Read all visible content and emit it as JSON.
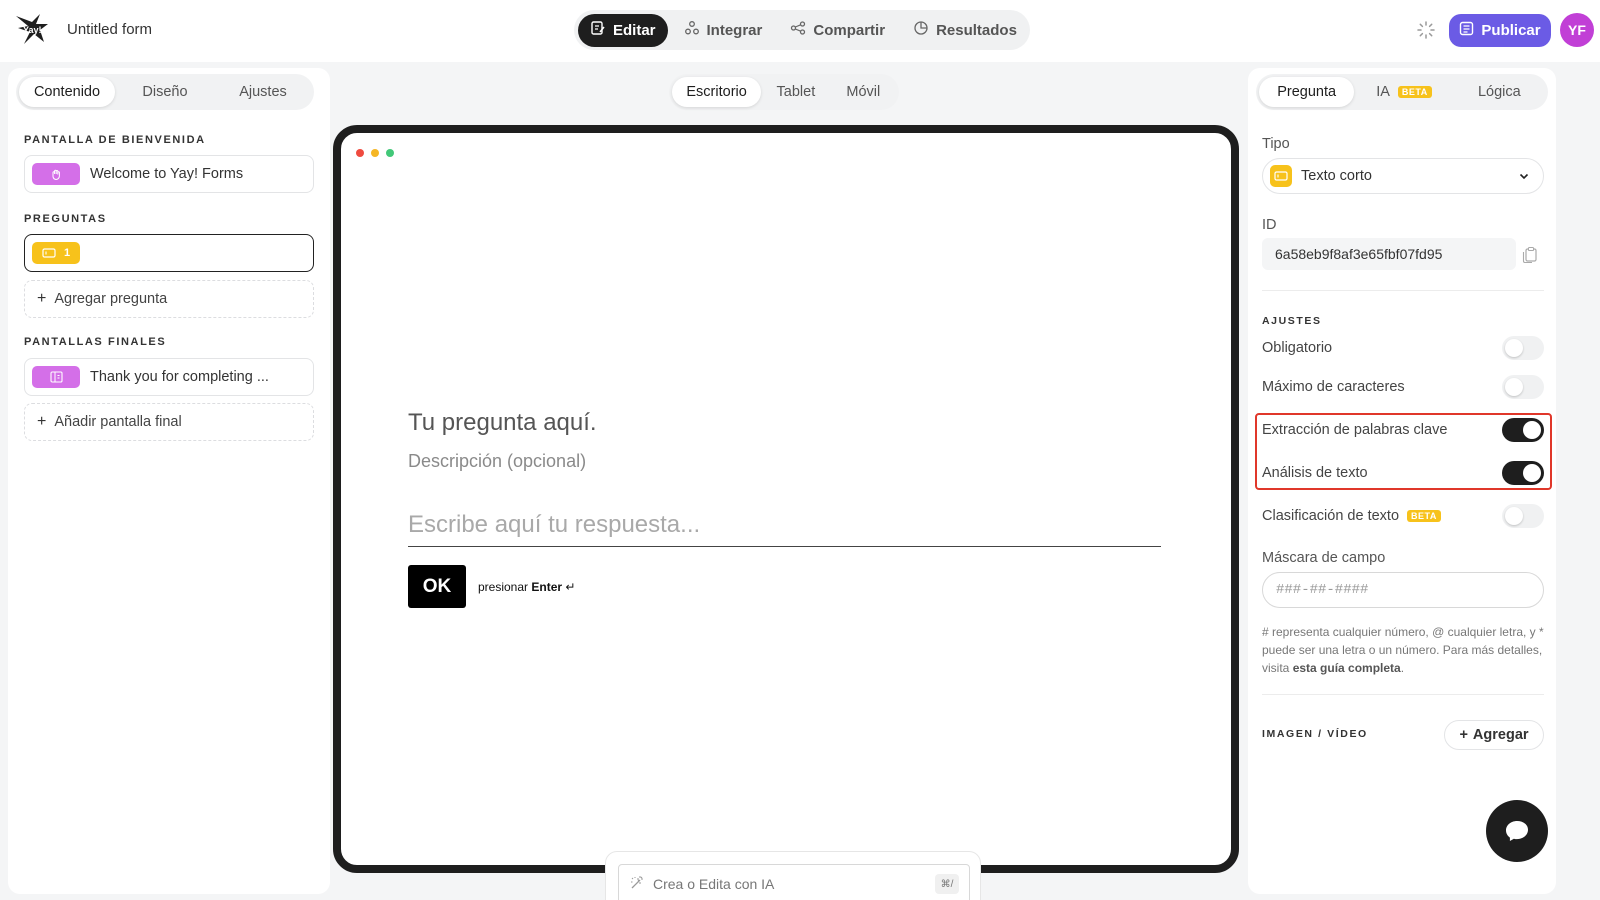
{
  "header": {
    "form_title": "Untitled form",
    "nav": [
      {
        "label": "Editar",
        "icon": "edit-icon",
        "active": true
      },
      {
        "label": "Integrar",
        "icon": "integrate-icon",
        "active": false
      },
      {
        "label": "Compartir",
        "icon": "share-icon",
        "active": false
      },
      {
        "label": "Resultados",
        "icon": "results-icon",
        "active": false
      }
    ],
    "publish_label": "Publicar",
    "avatar_initials": "YF"
  },
  "left": {
    "tabs": [
      {
        "label": "Contenido",
        "active": true
      },
      {
        "label": "Diseño",
        "active": false
      },
      {
        "label": "Ajustes",
        "active": false
      }
    ],
    "welcome_section": "PANTALLA DE BIENVENIDA",
    "welcome_item": "Welcome to Yay! Forms",
    "questions_section": "PREGUNTAS",
    "question_number": "1",
    "add_question": "Agregar pregunta",
    "endings_section": "PANTALLAS FINALES",
    "ending_item": "Thank you for completing ...",
    "add_ending": "Añadir pantalla final"
  },
  "center": {
    "devices": [
      {
        "label": "Escritorio",
        "active": true
      },
      {
        "label": "Tablet",
        "active": false
      },
      {
        "label": "Móvil",
        "active": false
      }
    ],
    "question_text": "Tu pregunta aquí.",
    "description": "Descripción (opcional)",
    "answer_placeholder": "Escribe aquí tu respuesta...",
    "ok_label": "OK",
    "press_label": "presionar",
    "enter_label": "Enter",
    "ai_placeholder": "Crea o Edita con IA",
    "ai_shortcut": "⌘/",
    "dot_colors": [
      "#ef4b3f",
      "#f5b625",
      "#42c878"
    ]
  },
  "right": {
    "tabs": [
      {
        "label": "Pregunta",
        "active": true
      },
      {
        "label": "IA",
        "active": false,
        "badge": "BETA"
      },
      {
        "label": "Lógica",
        "active": false
      }
    ],
    "type_label": "Tipo",
    "type_value": "Texto corto",
    "id_label": "ID",
    "id_value": "6a58eb9f8af3e65fbf07fd95",
    "settings_section": "AJUSTES",
    "settings": [
      {
        "label": "Obligatorio",
        "on": false
      },
      {
        "label": "Máximo de caracteres",
        "on": false
      },
      {
        "label": "Extracción de palabras clave",
        "on": true
      },
      {
        "label": "Análisis de texto",
        "on": true
      },
      {
        "label": "Clasificación de texto",
        "on": false,
        "badge": "BETA"
      }
    ],
    "mask_label": "Máscara de campo",
    "mask_placeholder": "###-##-####",
    "help_text_1": "# representa cualquier número, @ cualquier letra, y * puede ser una letra o un número. Para más detalles, visita ",
    "help_link": "esta guía completa",
    "help_text_2": ".",
    "media_section": "IMAGEN / VÍDEO",
    "add_label": "Agregar"
  },
  "colors": {
    "accent": "#6b5be5",
    "avatar": "#c13fd6",
    "welcome_chip": "#d46fe8",
    "question_chip": "#f7c21b",
    "highlight": "#e0372a",
    "dark": "#1e1e1e"
  }
}
